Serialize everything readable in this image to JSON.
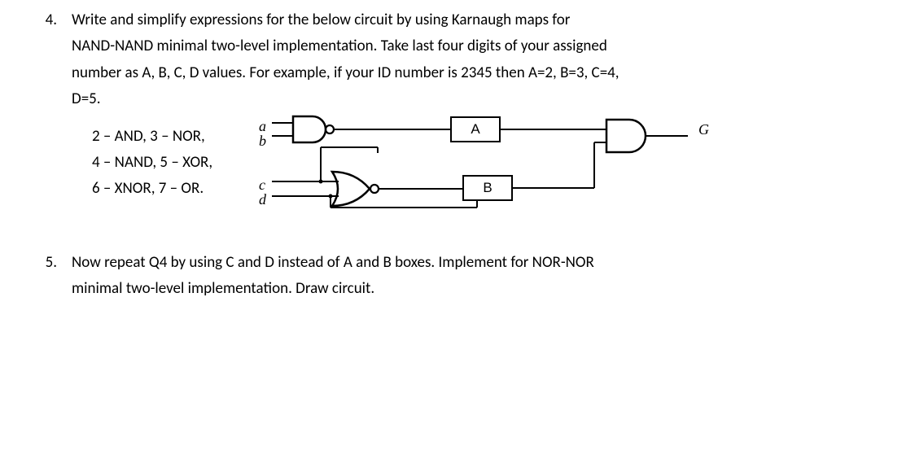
{
  "q4": {
    "number": "4.",
    "para1": "Write and simplify expressions for the below circuit by using Karnaugh maps for",
    "para2": "NAND-NAND minimal two-level implementation. Take last four digits of your assigned",
    "para3": "number as A, B, C, D values. For example, if your ID number is 2345 then A=2, B=3, C=4,",
    "para4": "D=5.",
    "legend1": "2 – AND, 3 – NOR,",
    "legend2": "4 – NAND, 5 – XOR,",
    "legend3": "6 – XNOR, 7 – OR.",
    "circuit": {
      "a": "a",
      "b": "b",
      "c": "c",
      "d": "d",
      "boxA": "A",
      "boxB": "B",
      "G": "G"
    }
  },
  "q5": {
    "number": "5.",
    "para1": "Now repeat Q4 by using C and D instead of A and B boxes. Implement for NOR-NOR",
    "para2": "minimal two-level implementation. Draw circuit."
  }
}
